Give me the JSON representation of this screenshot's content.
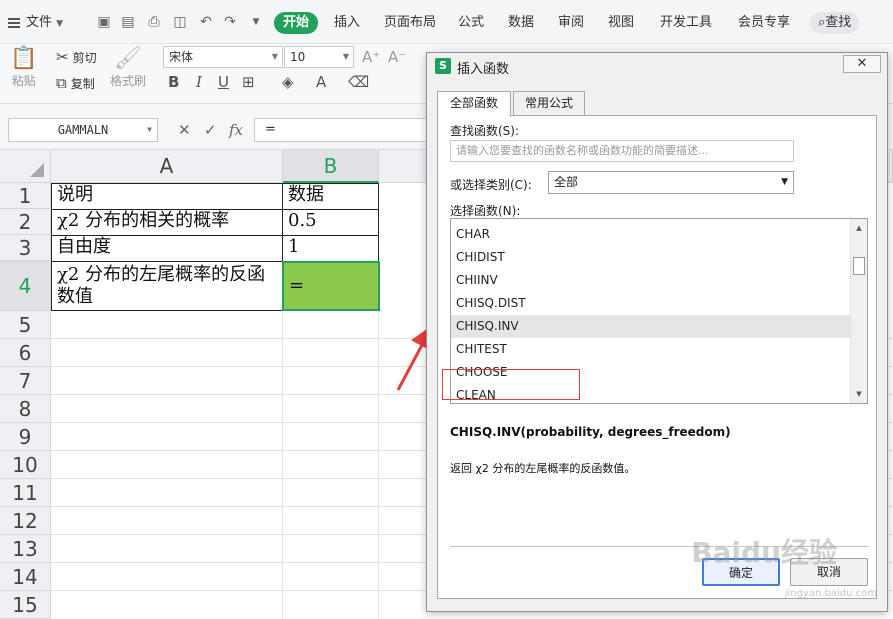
{
  "menubar": {
    "file_label": "文件",
    "tabs": [
      "开始",
      "插入",
      "页面布局",
      "公式",
      "数据",
      "审阅",
      "视图",
      "开发工具",
      "会员专享"
    ],
    "search_label": "查找"
  },
  "ribbon": {
    "paste_label": "粘贴",
    "cut_label": "剪切",
    "copy_label": "复制",
    "format_painter_label": "格式刷",
    "font_name": "宋体",
    "font_size": "10"
  },
  "formula_bar": {
    "name_box": "GAMMALN",
    "fx_label": "fx",
    "formula": "="
  },
  "sheet": {
    "columns": [
      "A",
      "B"
    ],
    "rows": [
      "1",
      "2",
      "3",
      "4",
      "5",
      "6",
      "7",
      "8",
      "9",
      "10",
      "11",
      "12",
      "13",
      "14",
      "15"
    ],
    "cells": {
      "A1": "说明",
      "B1": "数据",
      "A2": "χ2 分布的相关的概率",
      "B2": "0.5",
      "A3": "自由度",
      "B3": "1",
      "A4": "χ2 分布的左尾概率的反函数值",
      "B4": "="
    }
  },
  "dialog": {
    "title": "插入函数",
    "tabs": [
      "全部函数",
      "常用公式"
    ],
    "search_label": "查找函数(S):",
    "search_placeholder": "请输入您要查找的函数名称或函数功能的简要描述...",
    "category_label": "或选择类别(C):",
    "category_value": "全部",
    "select_label": "选择函数(N):",
    "functions": [
      "CHAR",
      "CHIDIST",
      "CHIINV",
      "CHISQ.DIST",
      "CHISQ.INV",
      "CHITEST",
      "CHOOSE",
      "CLEAN"
    ],
    "highlighted_function": "CHISQ.INV",
    "signature": "CHISQ.INV(probability, degrees_freedom)",
    "description": "返回 χ2 分布的左尾概率的反函数值。",
    "ok_label": "确定",
    "cancel_label": "取消"
  },
  "watermark": {
    "text": "Baidu经验",
    "sub": "jingyan.baidu.com"
  },
  "colors": {
    "accent_green": "#21a15c",
    "active_cell_fill": "#8ac84e",
    "annotation_red": "#e33d3d"
  }
}
